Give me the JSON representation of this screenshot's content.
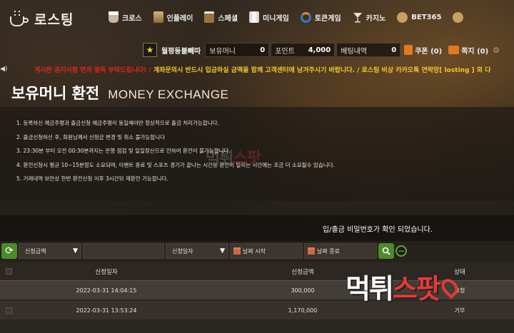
{
  "logo": {
    "text": "로스팅"
  },
  "nav": [
    {
      "label": "크로스",
      "icon": "coffee-icon"
    },
    {
      "label": "인플레이",
      "icon": "cup-icon"
    },
    {
      "label": "스페셜",
      "icon": "glass-icon"
    },
    {
      "label": "미니게임",
      "icon": "tube-icon"
    },
    {
      "label": "토큰게임",
      "icon": "token-icon"
    },
    {
      "label": "카지노",
      "icon": "cocktail-icon"
    },
    {
      "label": "BET365",
      "icon": "bet365-icon"
    }
  ],
  "userbar": {
    "username": "월평동불빼따",
    "money_label": "보유머니",
    "money_value": "0",
    "point_label": "포인트",
    "point_value": "4,000",
    "bet_label": "베팅내역",
    "bet_value": "0",
    "coupon_label": "쿠폰 (0)",
    "message_label": "쪽지 (0)"
  },
  "marquee": {
    "part1": "게시판 공지사항 먼저 필독 부탁드립니다! / ",
    "part2": "계좌문의시 반드시 입금하실 금액을 함께 고객센터에 남겨주시기 바랍니다. / 로스팅 비상 카카오톡 연락망[ losting ] 외 다"
  },
  "page": {
    "title_ko": "보유머니 환전",
    "title_en": "MONEY EXCHANGE"
  },
  "notices": [
    "1. 등록하신 예금주명과 출금신청 예금주명이 동일해야만 정상적으로 출금 처리가능합니다.",
    "2. 출금신청하신 후, 회원님께서 신청금 변경 및 취소 불가능합니다",
    "3. 23:30분 부터 오전 00:30분까지는 은행 점검 및 일일정산으로 인하여 환전이 불가능합니다.",
    "4. 환전신청시 평균 10~15분정도 소요되며, 이벤트 종료 및 스포츠 경기가 끝나는 시간등 환전이 밀리는 시간에는 조금 더 소요될수 있습니다.",
    "5. 거래내역 보안상 한번 환전신청 이후 3시간뒤 재환전 가능합니다."
  ],
  "confirm_message": "입/출금 비밀번호가 확인 되었습니다.",
  "filters": {
    "amount_select": "신청금액",
    "date_select": "신청일자",
    "start_date": "날짜 시작",
    "end_date": "날짜 종료"
  },
  "table": {
    "headers": {
      "date": "신청일자",
      "amount": "신청금액",
      "status": "상태"
    },
    "rows": [
      {
        "date": "2022-03-31 14:04:15",
        "amount": "300,000",
        "status": "요청"
      },
      {
        "date": "2022-03-31 13:53:24",
        "amount": "1,170,000",
        "status": "거부"
      }
    ]
  },
  "watermark": {
    "prefix": "먹튀",
    "accent": "스팟"
  },
  "colors": {
    "accent_green": "#4c8a2a",
    "marquee_red": "#e0261c",
    "marquee_yellow": "#f2c82a",
    "watermark_red": "#e63a36"
  }
}
